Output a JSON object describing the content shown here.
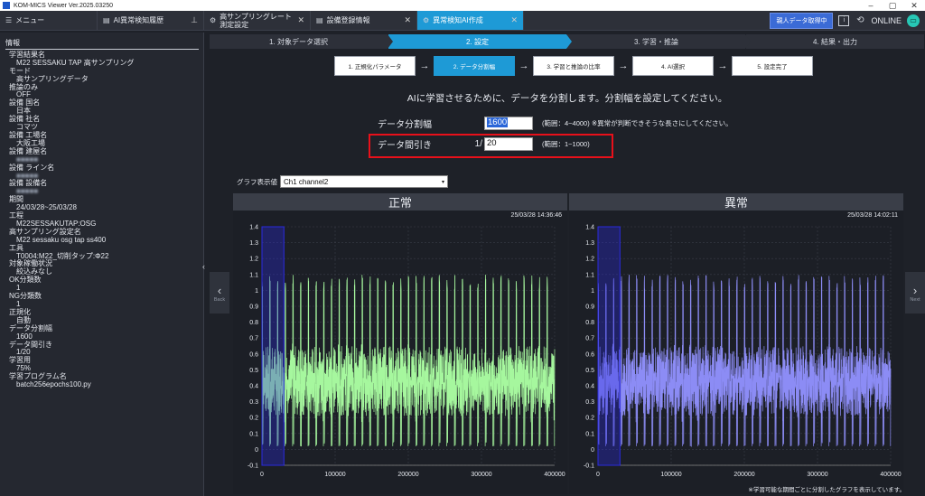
{
  "window": {
    "title": "KOM-MICS Viewer  Ver.2025.03250"
  },
  "tabs": [
    {
      "label": "メニュー",
      "icon": "menu-icon"
    },
    {
      "label": "AI異常検知履歴",
      "icon": "document-icon"
    },
    {
      "label": "高サンプリングレート\n測定設定",
      "icon": "gear-icon"
    },
    {
      "label": "設備登録情報",
      "icon": "document-icon"
    },
    {
      "label": "異常検知AI作成",
      "icon": "gear-icon"
    }
  ],
  "header_right": {
    "connect_label": "親人データ取得中",
    "online_label": "ONLINE"
  },
  "sidebar": {
    "title": "情報",
    "entries": [
      {
        "label": "学習結果名",
        "value": "M22 SESSAKU TAP 高サンプリング"
      },
      {
        "label": "モード",
        "value": "高サンプリングデータ"
      },
      {
        "label": "推論のみ",
        "value": "OFF"
      },
      {
        "label": "設備 国名",
        "value": "日本"
      },
      {
        "label": "設備 社名",
        "value": "コマツ"
      },
      {
        "label": "設備 工場名",
        "value": "大阪工場"
      },
      {
        "label": "設備 建屋名",
        "value": "■■■■■"
      },
      {
        "label": "設備 ライン名",
        "value": "■■■■■"
      },
      {
        "label": "設備 設備名",
        "value": "■■■■■"
      },
      {
        "label": "期間",
        "value": "24/03/28~25/03/28"
      },
      {
        "label": "工程",
        "value": "M22SESSAKUTAP:OSG"
      },
      {
        "label": "高サンプリング設定名",
        "value": "M22 sessaku osg tap ss400"
      },
      {
        "label": "工具",
        "value": "T0004:M22_切削タップ:Φ22"
      },
      {
        "label": "対象稼働状況",
        "value": "絞込みなし"
      },
      {
        "label": "OK分類数",
        "value": "1"
      },
      {
        "label": "NG分類数",
        "value": "1"
      },
      {
        "label": "正規化",
        "value": "自動"
      },
      {
        "label": "データ分割幅",
        "value": "1600"
      },
      {
        "label": "データ間引き",
        "value": "1/20"
      },
      {
        "label": "学習用",
        "value": "75%"
      },
      {
        "label": "学習プログラム名",
        "value": "batch256epochs100.py"
      }
    ]
  },
  "steps": [
    {
      "label": "1. 対象データ選択",
      "active": false
    },
    {
      "label": "2. 設定",
      "active": true
    },
    {
      "label": "3. 学習・推論",
      "active": false
    },
    {
      "label": "4. 結果・出力",
      "active": false
    }
  ],
  "substeps": [
    {
      "label": "1. 正規化パラメータ",
      "active": false
    },
    {
      "label": "2. データ分割幅",
      "active": true
    },
    {
      "label": "3. 学習と推論の比率",
      "active": false
    },
    {
      "label": "4. AI選択",
      "active": false
    },
    {
      "label": "5. 設定完了",
      "active": false
    }
  ],
  "instruction": "AIに学習させるために、データを分割します。分割幅を設定してください。",
  "form": {
    "split_label": "データ分割幅",
    "split_value": "1600",
    "split_range": "(範囲：4~4000) ※異常が判断できそうな長さにしてください。",
    "thin_label": "データ間引き",
    "thin_prefix": "1/",
    "thin_value": "20",
    "thin_range": "(範囲：1~1000)"
  },
  "graph_select": {
    "label": "グラフ表示値",
    "value": "Ch1 channel2"
  },
  "nav": {
    "back": "Back",
    "next": "Next"
  },
  "footnote": "※学習可能な期間ごとに分割したグラフを表示しています。",
  "colors": {
    "normal": "#a6f79e",
    "abnormal": "#8c8cf5",
    "accent": "#1e9ad6",
    "highlight": "#e8101a"
  },
  "chart_data": [
    {
      "type": "line",
      "title": "正常",
      "timestamp": "25/03/28 14:36:46",
      "xlim": [
        0,
        400000
      ],
      "ylim": [
        -0.1,
        1.4
      ],
      "xticks": [
        0,
        100000,
        200000,
        300000,
        400000
      ],
      "yticks": [
        -0.1,
        0,
        0.1,
        0.2,
        0.3,
        0.4,
        0.5,
        0.6,
        0.7,
        0.8,
        0.9,
        1,
        1.1,
        1.2,
        1.3,
        1.4
      ],
      "series": [
        {
          "color": "#a6f79e",
          "cycles": 38,
          "baseline": 0.42,
          "peak": 1.08,
          "low": 0.02
        }
      ],
      "selection": [
        0,
        30000
      ]
    },
    {
      "type": "line",
      "title": "異常",
      "timestamp": "25/03/28 14:02:11",
      "xlim": [
        0,
        400000
      ],
      "ylim": [
        -0.1,
        1.4
      ],
      "xticks": [
        0,
        100000,
        200000,
        300000,
        400000
      ],
      "yticks": [
        -0.1,
        0,
        0.1,
        0.2,
        0.3,
        0.4,
        0.5,
        0.6,
        0.7,
        0.8,
        0.9,
        1,
        1.1,
        1.2,
        1.3,
        1.4
      ],
      "series": [
        {
          "color": "#8c8cf5",
          "cycles": 38,
          "baseline": 0.42,
          "peak": 1.08,
          "low": 0.02
        }
      ],
      "selection": [
        0,
        30000
      ]
    }
  ]
}
